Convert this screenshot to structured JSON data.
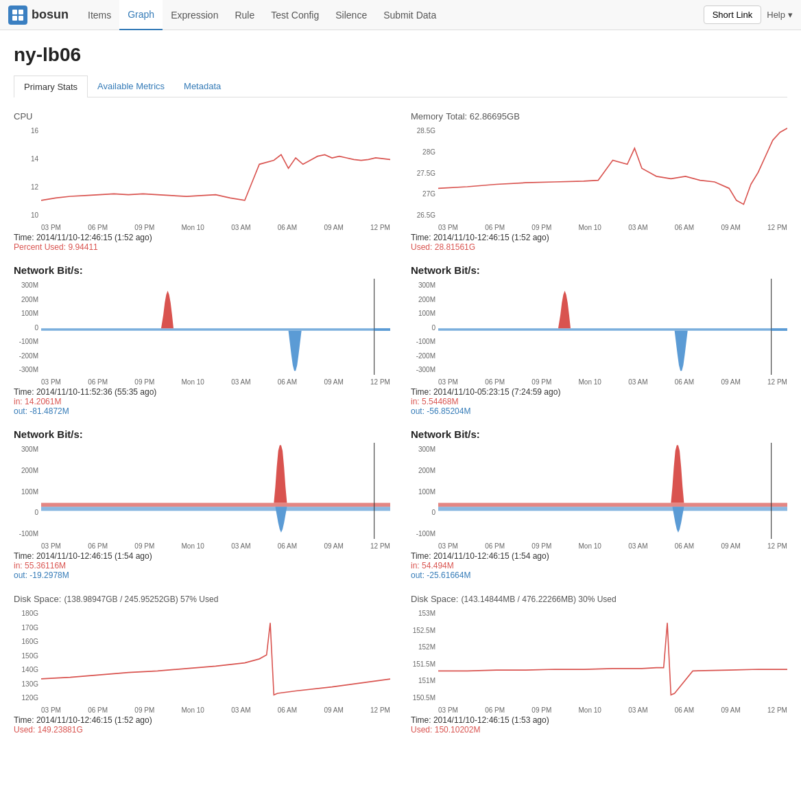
{
  "app": {
    "brand": "bosun",
    "logo_alt": "bosun logo"
  },
  "nav": {
    "items": [
      {
        "label": "Items",
        "active": false
      },
      {
        "label": "Graph",
        "active": true
      },
      {
        "label": "Expression",
        "active": false
      },
      {
        "label": "Rule",
        "active": false
      },
      {
        "label": "Test Config",
        "active": false
      },
      {
        "label": "Silence",
        "active": false
      },
      {
        "label": "Submit Data",
        "active": false
      }
    ],
    "short_link": "Short Link",
    "help": "Help"
  },
  "page": {
    "host": "ny-lb06"
  },
  "tabs": [
    {
      "label": "Primary Stats",
      "active": true
    },
    {
      "label": "Available Metrics",
      "active": false
    },
    {
      "label": "Metadata",
      "active": false
    }
  ],
  "sections": [
    {
      "id": "cpu-left",
      "title": "CPU",
      "title_extra": "",
      "time": "Time: 2014/11/10-12:46:15 (1:52 ago)",
      "values": [
        {
          "label": "Percent Used:",
          "val": "9.94411",
          "color": "red"
        }
      ],
      "chart_type": "cpu"
    },
    {
      "id": "memory-right",
      "title": "Memory",
      "title_extra": " Total: 62.86695GB",
      "time": "Time: 2014/11/10-12:46:15 (1:52 ago)",
      "values": [
        {
          "label": "Used:",
          "val": "28.81561G",
          "color": "red"
        }
      ],
      "chart_type": "memory"
    },
    {
      "id": "network1-left",
      "title": "Network Bit/s:",
      "title_extra": "",
      "time": "Time: 2014/11/10-11:52:36 (55:35 ago)",
      "values": [
        {
          "label": "in:",
          "val": "14.2061M",
          "color": "red"
        },
        {
          "label": "out:",
          "val": "-81.4872M",
          "color": "blue"
        }
      ],
      "chart_type": "network_blue_spike_down"
    },
    {
      "id": "network1-right",
      "title": "Network Bit/s:",
      "title_extra": "",
      "time": "Time: 2014/11/10-05:23:15 (7:24:59 ago)",
      "values": [
        {
          "label": "in:",
          "val": "5.54468M",
          "color": "red"
        },
        {
          "label": "out:",
          "val": "-56.85204M",
          "color": "blue"
        }
      ],
      "chart_type": "network_blue_spike_down2"
    },
    {
      "id": "network2-left",
      "title": "Network Bit/s:",
      "title_extra": "",
      "time": "Time: 2014/11/10-12:46:15 (1:54 ago)",
      "values": [
        {
          "label": "in:",
          "val": "55.36116M",
          "color": "red"
        },
        {
          "label": "out:",
          "val": "-19.2978M",
          "color": "blue"
        }
      ],
      "chart_type": "network_red_spike_up"
    },
    {
      "id": "network2-right",
      "title": "Network Bit/s:",
      "title_extra": "",
      "time": "Time: 2014/11/10-12:46:15 (1:54 ago)",
      "values": [
        {
          "label": "in:",
          "val": "54.494M",
          "color": "red"
        },
        {
          "label": "out:",
          "val": "-25.61664M",
          "color": "blue"
        }
      ],
      "chart_type": "network_red_spike_up2"
    },
    {
      "id": "disk-left",
      "title": "Disk Space:",
      "title_extra": " (138.98947GB / 245.95252GB) 57% Used",
      "time": "Time: 2014/11/10-12:46:15 (1:52 ago)",
      "values": [
        {
          "label": "Used:",
          "val": "149.23881G",
          "color": "red"
        }
      ],
      "chart_type": "disk_left"
    },
    {
      "id": "disk-right",
      "title": "Disk Space:",
      "title_extra": " (143.14844MB / 476.22266MB) 30% Used",
      "time": "Time: 2014/11/10-12:46:15 (1:53 ago)",
      "values": [
        {
          "label": "Used:",
          "val": "150.10202M",
          "color": "red"
        }
      ],
      "chart_type": "disk_right"
    }
  ],
  "x_axis_labels": [
    "03 PM",
    "06 PM",
    "09 PM",
    "Mon 10",
    "03 AM",
    "06 AM",
    "09 AM",
    "12 PM"
  ]
}
